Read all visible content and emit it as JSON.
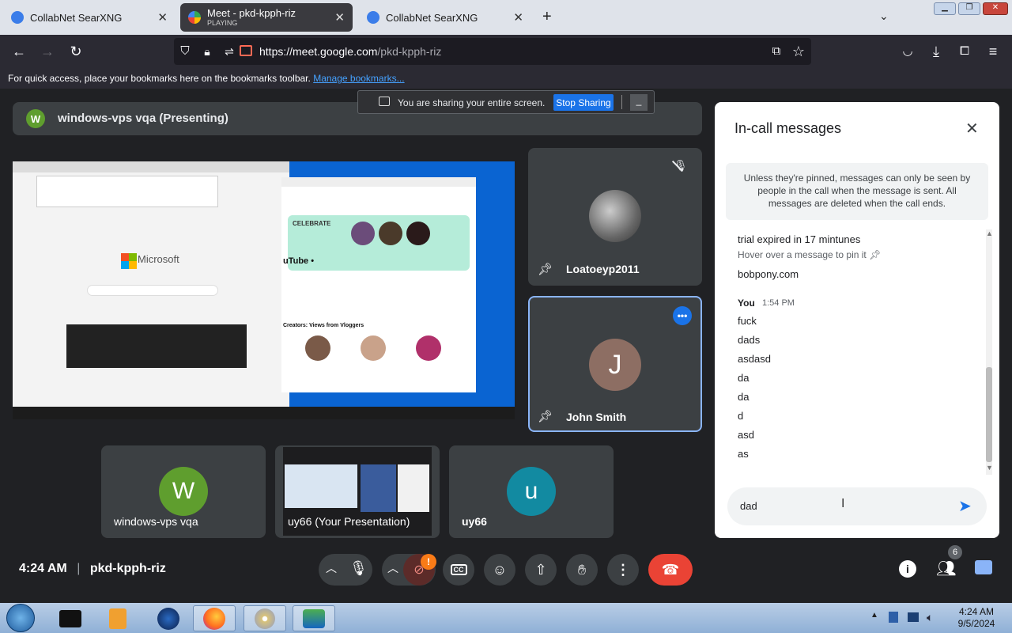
{
  "browser": {
    "tabs": [
      {
        "title": "CollabNet SearXNG"
      },
      {
        "title": "Meet - pkd-kpph-riz",
        "status": "PLAYING"
      },
      {
        "title": "CollabNet SearXNG"
      }
    ],
    "url_host": "https://meet.google.com",
    "url_path": "/pkd-kpph-riz",
    "bookmarks_text": "For quick access, place your bookmarks here on the bookmarks toolbar.",
    "bookmarks_link": "Manage bookmarks..."
  },
  "share_notice": {
    "text": "You are sharing your entire screen.",
    "stop_label": "Stop Sharing"
  },
  "presenting": {
    "avatar_letter": "W",
    "label": "windows-vps vqa (Presenting)"
  },
  "shared_screen": {
    "ms_label": "Microsoft",
    "yt_label": "uTube •",
    "celebrate": "CELEBRATE",
    "creators": "Creators: Views from Vloggers"
  },
  "participants": {
    "side": [
      {
        "name": "Loatoeyp2011"
      },
      {
        "name": "John Smith",
        "letter": "J"
      }
    ],
    "bottom": [
      {
        "name": "windows-vps vqa",
        "letter": "W"
      },
      {
        "name": "uy66 (Your Presentation)"
      },
      {
        "name": "uy66",
        "letter": "u"
      }
    ]
  },
  "chat": {
    "title": "In-call messages",
    "notice": "Unless they're pinned, messages can only be seen by people in the call when the message is sent. All messages are deleted when the call ends.",
    "messages_top": [
      "trial expired in 17 mintunes"
    ],
    "pin_hint": "Hover over a message to pin it",
    "messages_mid": [
      "bobpony.com"
    ],
    "sender": "You",
    "time": "1:54 PM",
    "my_messages": [
      "fuck",
      "dads",
      "asdasd",
      "da",
      "da",
      "d",
      "asd",
      "as"
    ],
    "input_value": "dad"
  },
  "bottom_bar": {
    "time": "4:24 AM",
    "meeting_code": "pkd-kpph-riz",
    "people_count": "6",
    "alert_badge": "!"
  },
  "taskbar": {
    "clock_time": "4:24 AM",
    "clock_date": "9/5/2024"
  },
  "colors": {
    "meet_bg": "#202124",
    "tile_bg": "#3c4043",
    "accent_blue": "#1a73e8",
    "end_call_red": "#ea4335"
  }
}
